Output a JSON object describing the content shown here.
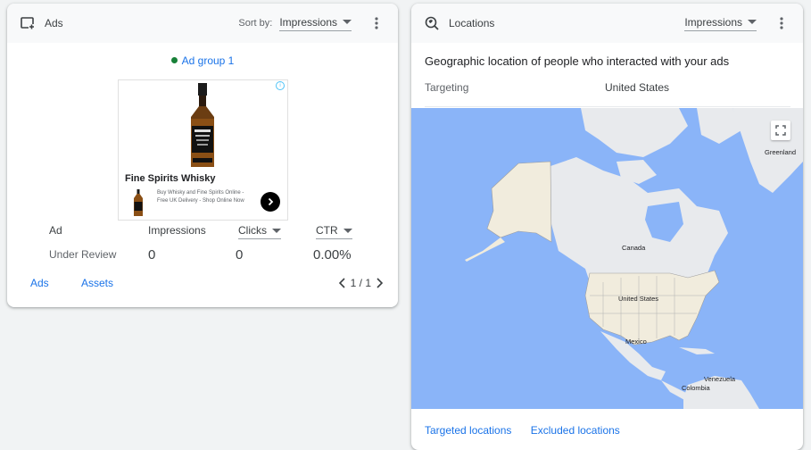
{
  "ads_card": {
    "title": "Ads",
    "icon": "add-to-queue-icon",
    "sort_label": "Sort by:",
    "sort_value": "Impressions",
    "ad_group": "Ad group 1",
    "ad_preview": {
      "title": "Fine Spirits Whisky",
      "description": "Buy Whisky and Fine Spirits Online - Free UK Delivery - Shop Online Now"
    },
    "table": {
      "headers": [
        "Ad",
        "Impressions",
        "Clicks",
        "CTR"
      ],
      "row": [
        "Under Review",
        "0",
        "0",
        "0.00%"
      ]
    },
    "footer": {
      "links": [
        "Ads",
        "Assets"
      ],
      "pager": "1 / 1"
    }
  },
  "locations_card": {
    "title": "Locations",
    "icon": "location-search-icon",
    "metric": "Impressions",
    "heading": "Geographic location of people who interacted with your ads",
    "targeting_label": "Targeting",
    "targeting_value": "United States",
    "map_labels": {
      "greenland": "Greenland",
      "canada": "Canada",
      "usa": "United States",
      "mexico": "Mexico",
      "venezuela": "Venezuela",
      "colombia": "Colombia"
    },
    "footer_links": [
      "Targeted locations",
      "Excluded locations"
    ]
  },
  "colors": {
    "link": "#1a73e8",
    "status_dot": "#188038",
    "ocean": "#8ab4f8",
    "land": "#e8eaed",
    "targeted_land": "#f1ecdd"
  }
}
